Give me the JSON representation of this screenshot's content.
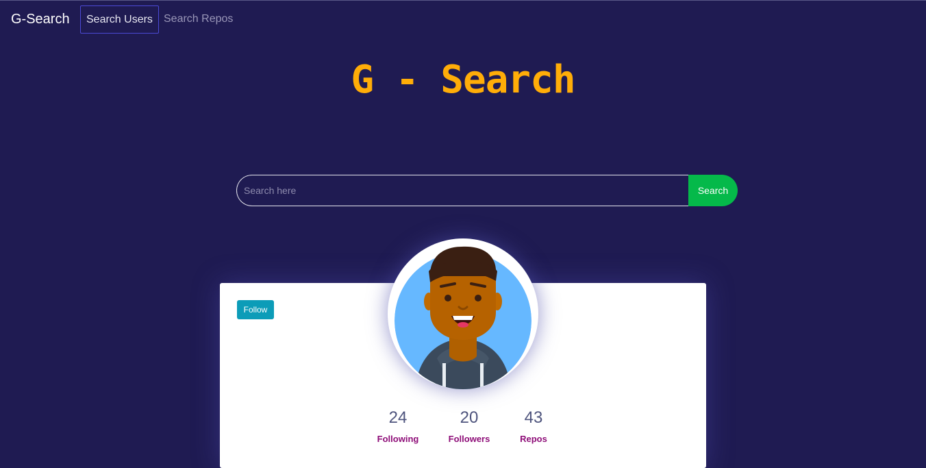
{
  "navbar": {
    "brand": "G-Search",
    "links": [
      {
        "label": "Search Users",
        "active": true
      },
      {
        "label": "Search Repos",
        "active": false
      }
    ]
  },
  "hero": {
    "title": "G - Search"
  },
  "search": {
    "placeholder": "Search here",
    "button_label": "Search"
  },
  "profile": {
    "follow_label": "Follow",
    "stats": [
      {
        "value": "24",
        "label": "Following"
      },
      {
        "value": "20",
        "label": "Followers"
      },
      {
        "value": "43",
        "label": "Repos"
      }
    ]
  },
  "colors": {
    "background": "#1f1b52",
    "accent_title": "#ffad08",
    "search_button": "#05b94a",
    "follow_button": "#0c9cb8",
    "stat_label": "#8e0d78"
  }
}
